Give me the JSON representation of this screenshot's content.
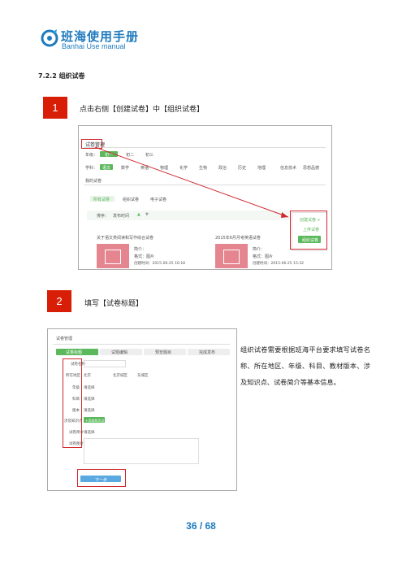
{
  "header": {
    "title": "班海使用手册",
    "subtitle": "Banhai Use manual"
  },
  "section_heading": "7.2.2 组织试卷",
  "step1": {
    "num": "1",
    "text": "点击右侧【创建试卷】中【组织试卷】"
  },
  "step2": {
    "num": "2",
    "text": "填写【试卷标题】"
  },
  "description": "组织试卷需要根据班海平台要求填写试卷名称、所在地区、年级、科目、教材版本、涉及知识点、试卷简介等基本信息。",
  "page_number": "36 / 68",
  "shot1": {
    "title": "试卷管理",
    "grade_label": "年级：",
    "grades": [
      "初一",
      "初二",
      "初三"
    ],
    "subject_label": "学科：",
    "subjects": [
      "语文",
      "数学",
      "英语",
      "物理",
      "化学",
      "生物",
      "政治",
      "历史",
      "地理",
      "信息技术",
      "思想品德"
    ],
    "my_papers": "我的试卷",
    "tabs": [
      "所有试卷",
      "组织试卷",
      "电子试卷"
    ],
    "sort_label": "排序：",
    "sort_value": "发布时间",
    "menu": [
      "创建试卷 ∨",
      "上传试卷",
      "组织试卷"
    ],
    "cards": [
      {
        "title": "关于语文类阅读和写作综合试卷",
        "intro": "简介：",
        "format": "格式：图片",
        "date": "创建时间：2015-06-25 16:18"
      },
      {
        "title": "2015年6月月考英语试卷",
        "intro": "简介：",
        "format": "格式：图片",
        "date": "创建时间：2015-06-25 15:32"
      }
    ]
  },
  "shot2": {
    "title": "试卷管理",
    "steps": [
      "试卷标题",
      "试题编辑",
      "预览题目",
      "完成发布"
    ],
    "fields": [
      "试卷名称",
      "所在地区",
      "年级",
      "科目",
      "版本",
      "涉及知识点",
      "试卷简介",
      "试卷图片"
    ],
    "region_values": [
      "北京",
      "北京城区",
      "东城区"
    ],
    "select_placeholder": "请选择",
    "kp_button": "+添加知识点",
    "next_button": "下一步"
  }
}
